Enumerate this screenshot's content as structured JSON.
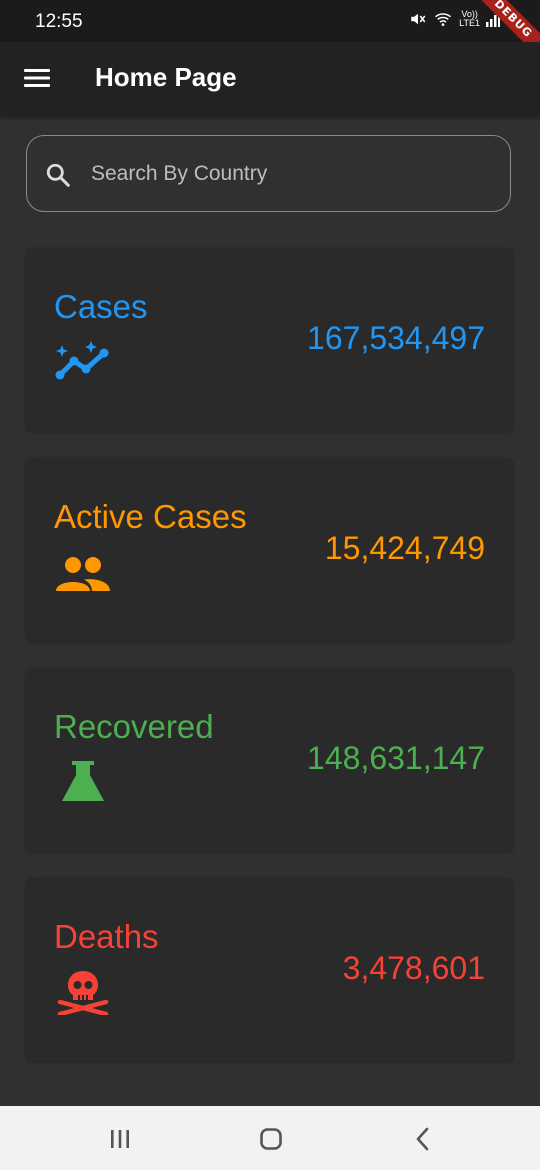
{
  "status_bar": {
    "time": "12:55",
    "lte_label": "Vo))\nLTE1",
    "debug_label": "DEBUG",
    "icons": [
      "mute-icon",
      "wifi-icon",
      "lte-icon",
      "signal-icon"
    ]
  },
  "app_bar": {
    "title": "Home Page",
    "menu_icon": "menu-icon"
  },
  "search": {
    "placeholder": "Search By Country",
    "value": "",
    "icon": "search-icon"
  },
  "stats": [
    {
      "label": "Cases",
      "value": "167,534,497",
      "color": "#2196f3",
      "icon": "auto-graph-icon"
    },
    {
      "label": "Active Cases",
      "value": "15,424,749",
      "color": "#ff9800",
      "icon": "people-icon"
    },
    {
      "label": "Recovered",
      "value": "148,631,147",
      "color": "#4caf50",
      "icon": "flask-icon"
    },
    {
      "label": "Deaths",
      "value": "3,478,601",
      "color": "#f44336",
      "icon": "skull-crossbones-icon"
    }
  ],
  "colors": {
    "background": "#303030",
    "app_bar": "#222222",
    "card": "#2a2a2a",
    "nav_bar": "#f2f2f2"
  },
  "nav_bar": {
    "icons": [
      "recents-icon",
      "home-icon",
      "back-icon"
    ]
  }
}
